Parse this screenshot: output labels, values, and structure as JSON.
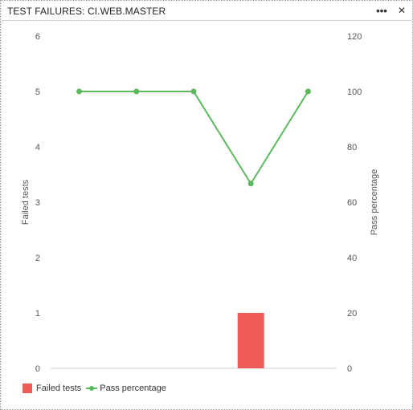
{
  "header": {
    "title": "TEST FAILURES: CI.WEB.MASTER",
    "more_label": "•••",
    "close_label": "✕"
  },
  "colors": {
    "failed": "#f05a57",
    "pass": "#5cb85c",
    "axis_text": "#555555",
    "baseline": "#cccccc"
  },
  "chart_data": {
    "type": "bar",
    "categories": [
      "",
      "",
      "",
      "",
      ""
    ],
    "series": [
      {
        "name": "Failed tests",
        "type": "bar",
        "axis": "left",
        "values": [
          0,
          0,
          0,
          1,
          0
        ]
      },
      {
        "name": "Pass percentage",
        "type": "line",
        "axis": "right",
        "values": [
          100,
          100,
          100,
          66.7,
          100
        ]
      }
    ],
    "ylabel": "Failed tests",
    "ylabel_right": "Pass percentage",
    "ylim": [
      0,
      6
    ],
    "ylim_right": [
      0,
      120
    ],
    "yticks": [
      0,
      1,
      2,
      3,
      4,
      5,
      6
    ],
    "yticks_right": [
      0,
      20,
      40,
      60,
      80,
      100,
      120
    ],
    "grid": false,
    "legend_position": "bottom-left"
  },
  "legend": {
    "failed_label": "Failed tests",
    "pass_label": "Pass percentage"
  }
}
